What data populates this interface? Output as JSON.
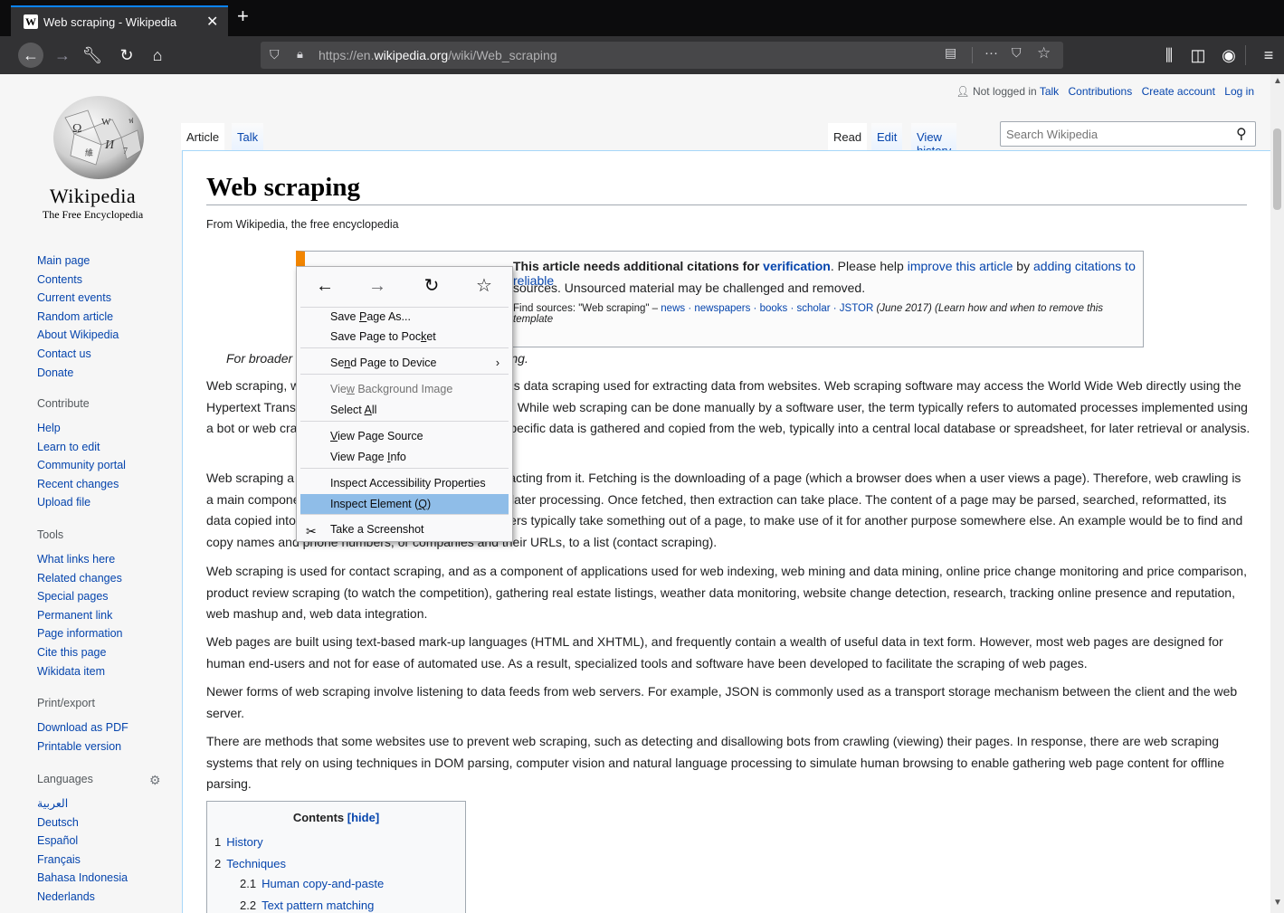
{
  "browser": {
    "tab": {
      "title": "Web scraping - Wikipedia",
      "favicon": "W"
    },
    "url_prefix": "https://en.",
    "url_domain": "wikipedia.org",
    "url_path": "/wiki/Web_scraping"
  },
  "logo": {
    "wordmark": "Wikipedia",
    "tagline": "The Free Encyclopedia"
  },
  "personal": {
    "not_logged_in": "Not logged in",
    "talk": "Talk",
    "contributions": "Contributions",
    "create_account": "Create account",
    "log_in": "Log in"
  },
  "tabs": {
    "article": "Article",
    "talk": "Talk",
    "read": "Read",
    "edit": "Edit",
    "view_history": "View history"
  },
  "search": {
    "placeholder": "Search Wikipedia"
  },
  "nav": {
    "main": [
      "Main page",
      "Contents",
      "Current events",
      "Random article",
      "About Wikipedia",
      "Contact us",
      "Donate"
    ],
    "contribute_heading": "Contribute",
    "contribute": [
      "Help",
      "Learn to edit",
      "Community portal",
      "Recent changes",
      "Upload file"
    ],
    "tools_heading": "Tools",
    "tools": [
      "What links here",
      "Related changes",
      "Special pages",
      "Permanent link",
      "Page information",
      "Cite this page",
      "Wikidata item"
    ],
    "print_heading": "Print/export",
    "print": [
      "Download as PDF",
      "Printable version"
    ],
    "languages_heading": "Languages",
    "languages": [
      "العربية",
      "Deutsch",
      "Español",
      "Français",
      "Bahasa Indonesia",
      "Nederlands"
    ]
  },
  "article": {
    "title": "Web scraping",
    "sitesub": "From Wikipedia, the free encyclopedia",
    "ambox_line1_a": "This article needs additional citations for ",
    "ambox_line1_link": "verification",
    "ambox_line1_b": ". Please help ",
    "ambox_line1_link2": "improve this article",
    "ambox_line1_c": " by ",
    "ambox_line1_link3": "adding citations to reliable",
    "ambox_line2": "sources. Unsourced material may be challenged and removed.",
    "ambox_line3_a": "Find sources: \"Web scraping\" – ",
    "ambox_line3_links": "news · newspapers · books · scholar · JSTOR",
    "ambox_line3_b": " (June 2017) (Learn how and when to remove this template",
    "hatnote": "For broader coverage of this topic, see Data scraping.",
    "p1": "Web scraping, web harvesting, or web data extraction is data scraping used for extracting data from websites. Web scraping software may access the World Wide Web directly using the Hypertext Transfer Protocol, or through a web browser. While web scraping can be done manually by a software user, the term typically refers to automated processes implemented using a bot or web crawler. It is a form of copying, in which specific data is gathered and copied from the web, typically into a central local database or spreadsheet, for later retrieval or analysis.",
    "p2": "Web scraping a web page involves fetching it and extracting from it. Fetching is the downloading of a page (which a browser does when a user views a page). Therefore, web crawling is a main component of web scraping, to fetch pages for later processing. Once fetched, then extraction can take place. The content of a page may be parsed, searched, reformatted, its data copied into a spreadsheet, and so on. Web scrapers typically take something out of a page, to make use of it for another purpose somewhere else. An example would be to find and copy names and phone numbers, or companies and their URLs, to a list (contact scraping).",
    "p3": "Web scraping is used for contact scraping, and as a component of applications used for web indexing, web mining and data mining, online price change monitoring and price comparison, product review scraping (to watch the competition), gathering real estate listings, weather data monitoring, website change detection, research, tracking online presence and reputation, web mashup and, web data integration.",
    "p4": "Web pages are built using text-based mark-up languages (HTML and XHTML), and frequently contain a wealth of useful data in text form. However, most web pages are designed for human end-users and not for ease of automated use. As a result, specialized tools and software have been developed to facilitate the scraping of web pages.",
    "p5": "Newer forms of web scraping involve listening to data feeds from web servers. For example, JSON is commonly used as a transport storage mechanism between the client and the web server.",
    "p6": "There are methods that some websites use to prevent web scraping, such as detecting and disallowing bots from crawling (viewing) their pages. In response, there are web scraping systems that rely on using techniques in DOM parsing, computer vision and natural language processing to simulate human browsing to enable gathering web page content for offline parsing."
  },
  "toc": {
    "title": "Contents",
    "hide": "[hide]",
    "items": [
      {
        "num": "1",
        "text": "History",
        "sub": false
      },
      {
        "num": "2",
        "text": "Techniques",
        "sub": false
      },
      {
        "num": "2.1",
        "text": "Human copy-and-paste",
        "sub": true
      },
      {
        "num": "2.2",
        "text": "Text pattern matching",
        "sub": true
      }
    ]
  },
  "context_menu": {
    "items": [
      {
        "label_pre": "Save ",
        "accel": "P",
        "label_post": "age As...",
        "disabled": false
      },
      {
        "label_pre": "Save Page to Poc",
        "accel": "k",
        "label_post": "et",
        "disabled": false
      },
      {
        "label_pre": "Se",
        "accel": "n",
        "label_post": "d Page to Device",
        "disabled": false,
        "submenu": true
      },
      {
        "label_pre": "Vie",
        "accel": "w",
        "label_post": " Background Image",
        "disabled": true
      },
      {
        "label_pre": "Select ",
        "accel": "A",
        "label_post": "ll",
        "disabled": false
      },
      {
        "label_pre": "",
        "accel": "V",
        "label_post": "iew Page Source",
        "disabled": false
      },
      {
        "label_pre": "View Page ",
        "accel": "I",
        "label_post": "nfo",
        "disabled": false
      },
      {
        "label_pre": "Inspect Accessibility Properties",
        "accel": "",
        "label_post": "",
        "disabled": false
      },
      {
        "label_pre": "Inspect Element (",
        "accel": "Q",
        "label_post": ")",
        "disabled": false,
        "hover": true
      },
      {
        "label_pre": "Take a Screenshot",
        "accel": "",
        "label_post": "",
        "disabled": false
      }
    ]
  },
  "colors": {
    "link": "#0645ad",
    "hover": "#8fbde8",
    "accent": "#0a84ff",
    "ambox_border": "#f28500"
  }
}
